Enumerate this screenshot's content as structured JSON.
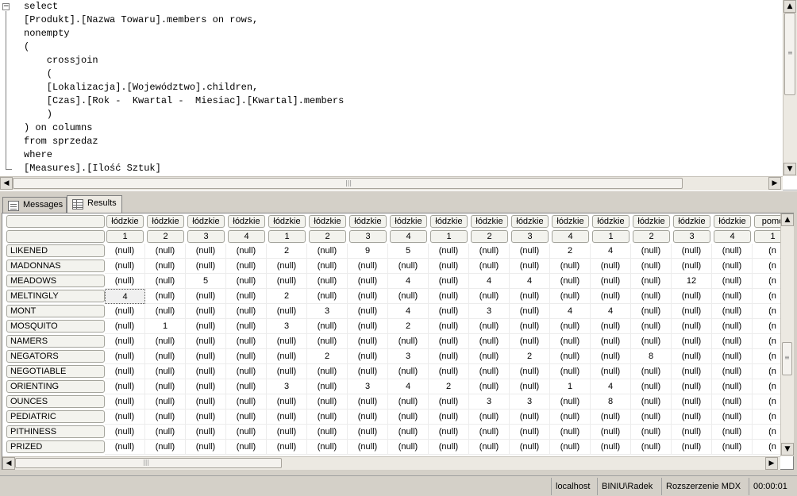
{
  "editor": {
    "lines": [
      "select",
      "[Produkt].[Nazwa Towaru].members on rows,",
      "nonempty",
      "(",
      "    crossjoin",
      "    (",
      "    [Lokalizacja].[Województwo].children,",
      "    [Czas].[Rok -  Kwartal -  Miesiac].[Kwartal].members",
      "    )",
      ") on columns",
      "from sprzedaz",
      "where",
      "[Measures].[Ilość Sztuk]"
    ]
  },
  "tabs": {
    "messages_label": "Messages",
    "results_label": "Results",
    "active": "results"
  },
  "grid": {
    "column_headers_level1": [
      "łódzkie",
      "łódzkie",
      "łódzkie",
      "łódzkie",
      "łódzkie",
      "łódzkie",
      "łódzkie",
      "łódzkie",
      "łódzkie",
      "łódzkie",
      "łódzkie",
      "łódzkie",
      "łódzkie",
      "łódzkie",
      "łódzkie",
      "łódzkie",
      "pomo"
    ],
    "column_headers_level2": [
      "1",
      "2",
      "3",
      "4",
      "1",
      "2",
      "3",
      "4",
      "1",
      "2",
      "3",
      "4",
      "1",
      "2",
      "3",
      "4",
      "1"
    ],
    "rows": [
      {
        "name": "LIKENED",
        "values": [
          "(null)",
          "(null)",
          "(null)",
          "(null)",
          "2",
          "(null)",
          "9",
          "5",
          "(null)",
          "(null)",
          "(null)",
          "2",
          "4",
          "(null)",
          "(null)",
          "(null)",
          "(n"
        ]
      },
      {
        "name": "MADONNAS",
        "values": [
          "(null)",
          "(null)",
          "(null)",
          "(null)",
          "(null)",
          "(null)",
          "(null)",
          "(null)",
          "(null)",
          "(null)",
          "(null)",
          "(null)",
          "(null)",
          "(null)",
          "(null)",
          "(null)",
          "(n"
        ]
      },
      {
        "name": "MEADOWS",
        "values": [
          "(null)",
          "(null)",
          "5",
          "(null)",
          "(null)",
          "(null)",
          "(null)",
          "4",
          "(null)",
          "4",
          "4",
          "(null)",
          "(null)",
          "(null)",
          "12",
          "(null)",
          "(n"
        ]
      },
      {
        "name": "MELTINGLY",
        "values": [
          "4",
          "(null)",
          "(null)",
          "(null)",
          "2",
          "(null)",
          "(null)",
          "(null)",
          "(null)",
          "(null)",
          "(null)",
          "(null)",
          "(null)",
          "(null)",
          "(null)",
          "(null)",
          "(n"
        ]
      },
      {
        "name": "MONT",
        "values": [
          "(null)",
          "(null)",
          "(null)",
          "(null)",
          "(null)",
          "3",
          "(null)",
          "4",
          "(null)",
          "3",
          "(null)",
          "4",
          "4",
          "(null)",
          "(null)",
          "(null)",
          "(n"
        ]
      },
      {
        "name": "MOSQUITO",
        "values": [
          "(null)",
          "1",
          "(null)",
          "(null)",
          "3",
          "(null)",
          "(null)",
          "2",
          "(null)",
          "(null)",
          "(null)",
          "(null)",
          "(null)",
          "(null)",
          "(null)",
          "(null)",
          "(n"
        ]
      },
      {
        "name": "NAMERS",
        "values": [
          "(null)",
          "(null)",
          "(null)",
          "(null)",
          "(null)",
          "(null)",
          "(null)",
          "(null)",
          "(null)",
          "(null)",
          "(null)",
          "(null)",
          "(null)",
          "(null)",
          "(null)",
          "(null)",
          "(n"
        ]
      },
      {
        "name": "NEGATORS",
        "values": [
          "(null)",
          "(null)",
          "(null)",
          "(null)",
          "(null)",
          "2",
          "(null)",
          "3",
          "(null)",
          "(null)",
          "2",
          "(null)",
          "(null)",
          "8",
          "(null)",
          "(null)",
          "(n"
        ]
      },
      {
        "name": "NEGOTIABLE",
        "values": [
          "(null)",
          "(null)",
          "(null)",
          "(null)",
          "(null)",
          "(null)",
          "(null)",
          "(null)",
          "(null)",
          "(null)",
          "(null)",
          "(null)",
          "(null)",
          "(null)",
          "(null)",
          "(null)",
          "(n"
        ]
      },
      {
        "name": "ORIENTING",
        "values": [
          "(null)",
          "(null)",
          "(null)",
          "(null)",
          "3",
          "(null)",
          "3",
          "4",
          "2",
          "(null)",
          "(null)",
          "1",
          "4",
          "(null)",
          "(null)",
          "(null)",
          "(n"
        ]
      },
      {
        "name": "OUNCES",
        "values": [
          "(null)",
          "(null)",
          "(null)",
          "(null)",
          "(null)",
          "(null)",
          "(null)",
          "(null)",
          "(null)",
          "3",
          "3",
          "(null)",
          "8",
          "(null)",
          "(null)",
          "(null)",
          "(n"
        ]
      },
      {
        "name": "PEDIATRIC",
        "values": [
          "(null)",
          "(null)",
          "(null)",
          "(null)",
          "(null)",
          "(null)",
          "(null)",
          "(null)",
          "(null)",
          "(null)",
          "(null)",
          "(null)",
          "(null)",
          "(null)",
          "(null)",
          "(null)",
          "(n"
        ]
      },
      {
        "name": "PITHINESS",
        "values": [
          "(null)",
          "(null)",
          "(null)",
          "(null)",
          "(null)",
          "(null)",
          "(null)",
          "(null)",
          "(null)",
          "(null)",
          "(null)",
          "(null)",
          "(null)",
          "(null)",
          "(null)",
          "(null)",
          "(n"
        ]
      },
      {
        "name": "PRIZED",
        "values": [
          "(null)",
          "(null)",
          "(null)",
          "(null)",
          "(null)",
          "(null)",
          "(null)",
          "(null)",
          "(null)",
          "(null)",
          "(null)",
          "(null)",
          "(null)",
          "(null)",
          "(null)",
          "(null)",
          "(n"
        ]
      }
    ],
    "selected_cell": {
      "row": 3,
      "col": 0
    }
  },
  "status": {
    "server": "localhost",
    "user": "BINIU\\Radek",
    "database": "Rozszerzenie MDX",
    "elapsed": "00:00:01"
  },
  "icons": {
    "messages_tab_icon": "messages-icon",
    "results_tab_icon": "grid-icon"
  }
}
